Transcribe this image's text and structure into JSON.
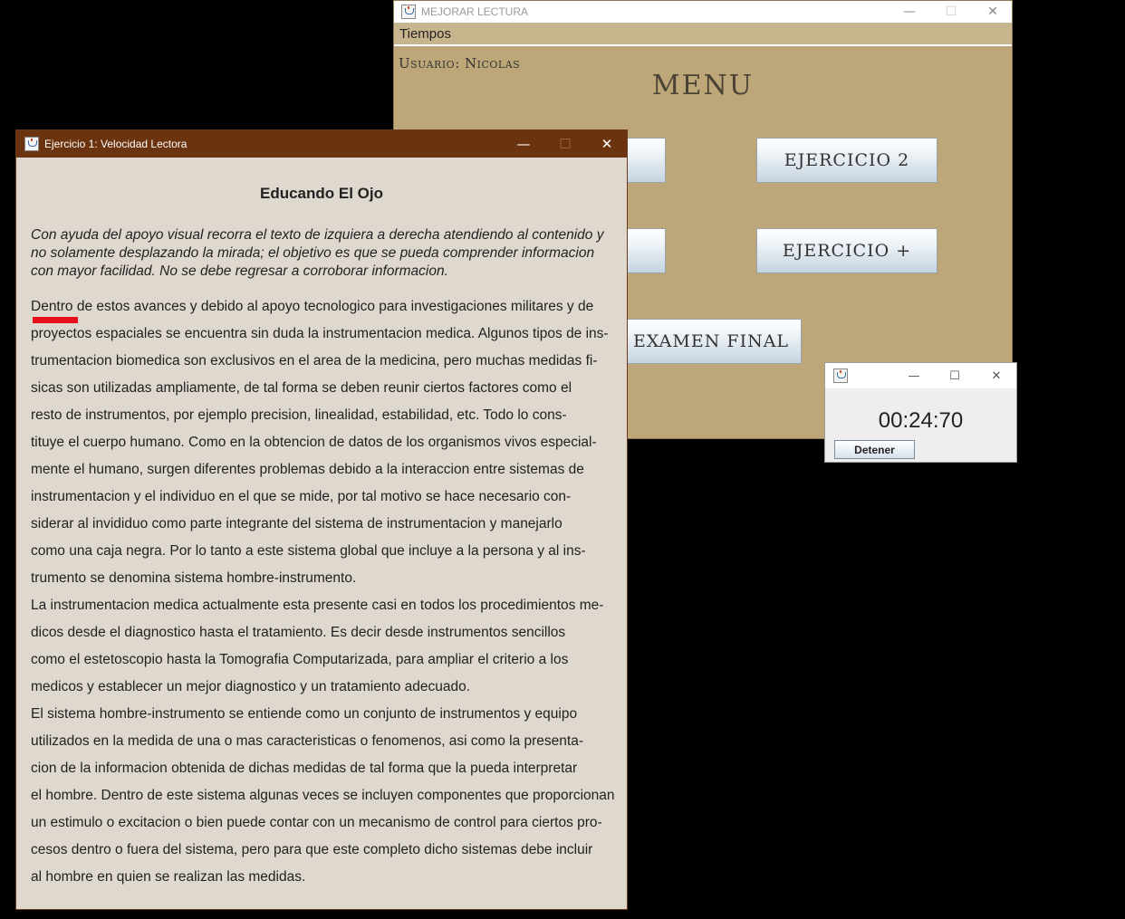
{
  "menu_window": {
    "title": "MEJORAR LECTURA",
    "controls": {
      "minimize": "—",
      "maximize": "☐",
      "close": "✕"
    },
    "menubar": {
      "tiempos": "Tiempos"
    },
    "user_label": "Usuario: Nicolas",
    "heading": "MENU",
    "buttons": {
      "ejercicio_1": "",
      "ejercicio_2": "EJERCICIO 2",
      "ejercicio_3": "",
      "ejercicio_mas": "EJERCICIO +",
      "examen_final": "EXAMEN FINAL"
    }
  },
  "exercise_window": {
    "title": "Ejercicio 1: Velocidad Lectora",
    "controls": {
      "minimize": "—",
      "maximize": "☐",
      "close": "✕"
    },
    "heading": "Educando El Ojo",
    "instructions": "Con ayuda del apoyo visual recorra el texto de izquiera a derecha atendiendo al contenido y no solamente desplazando la mirada; el objetivo es que se pueda comprender informacion con mayor facilidad. No se debe regresar a corroborar informacion.",
    "reading_lines": [
      "Dentro de estos avances y debido al apoyo tecnologico para investigaciones militares y de",
      "proyectos espaciales se encuentra sin duda la instrumentacion medica. Algunos tipos de ins-",
      "trumentacion biomedica son exclusivos en el area de la medicina, pero muchas medidas fi-",
      "sicas son utilizadas ampliamente, de tal forma se deben reunir ciertos factores como el",
      "resto de instrumentos, por ejemplo precision, linealidad, estabilidad, etc. Todo lo cons-",
      "tituye el cuerpo humano. Como en la obtencion de datos de los organismos vivos especial-",
      "mente el humano, surgen diferentes problemas debido a la interaccion entre sistemas de",
      "instrumentacion y el individuo en el que se mide, por tal motivo se hace necesario con-",
      "siderar al invididuo como parte integrante del sistema de instrumentacion y manejarlo",
      "como una caja negra. Por lo tanto a este sistema global que incluye a la persona y al ins-",
      "trumento se denomina sistema hombre-instrumento.",
      "La instrumentacion medica actualmente esta presente casi en todos los procedimientos me-",
      "dicos desde el diagnostico hasta el tratamiento. Es decir desde instrumentos sencillos",
      "como el estetoscopio hasta la Tomografia Computarizada, para ampliar el criterio a los",
      "medicos y establecer un mejor diagnostico y un tratamiento adecuado.",
      "El sistema hombre-instrumento se entiende como un conjunto de instrumentos y equipo",
      "utilizados en la medida de una o mas caracteristicas o fenomenos, asi como la presenta-",
      "cion de la informacion obtenida de dichas medidas de tal forma que la pueda interpretar",
      "el hombre. Dentro de este sistema algunas veces se incluyen componentes que proporcionan",
      "un estimulo o excitacion o bien puede contar con un mecanismo de control para ciertos pro-",
      "cesos dentro o fuera del sistema, pero para que este completo dicho sistemas debe incluir",
      "al hombre en quien se realizan las medidas."
    ],
    "guide_color": "#e8101a"
  },
  "timer_window": {
    "controls": {
      "minimize": "—",
      "maximize": "☐",
      "close": "✕"
    },
    "time": "00:24:70",
    "stop_label": "Detener"
  }
}
